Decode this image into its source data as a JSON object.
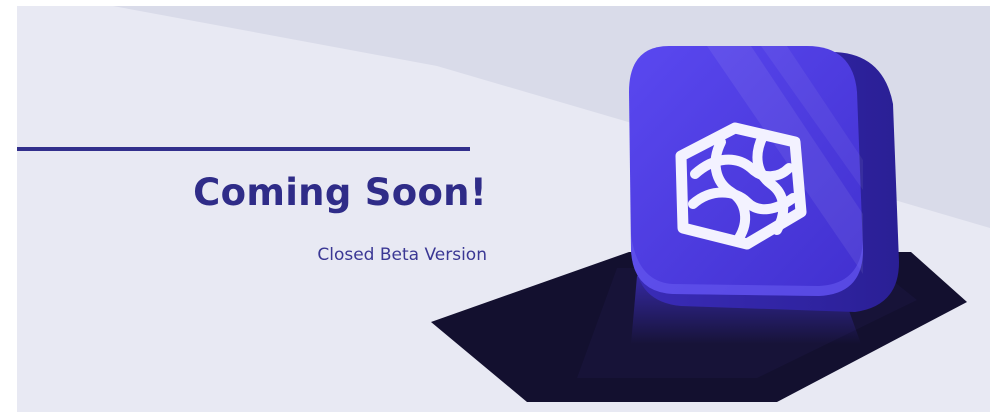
{
  "banner": {
    "headline": "Coming Soon!",
    "subline": "Closed Beta Version",
    "icon": "beta-app-icon"
  },
  "colors": {
    "background_light": "#e8e9f3",
    "background_band": "#d9dbe9",
    "accent_dark_blue": "#2f2c88",
    "icon_face": "#4f3fe0",
    "icon_side": "#2f23a6",
    "shadow": "#13102f"
  }
}
